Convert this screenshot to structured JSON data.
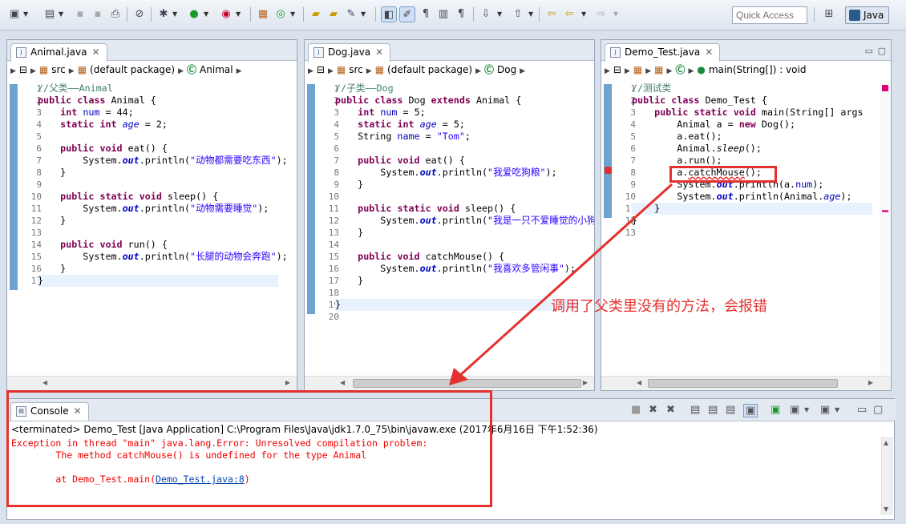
{
  "toolbar": {
    "quick_access_placeholder": "Quick Access",
    "perspective_label": "Java",
    "icons": [
      "new-icon",
      "save-icon",
      "save-all-icon",
      "print-icon",
      "debug-icon",
      "run-icon",
      "external-tools-icon",
      "new-java-project-icon",
      "new-package-icon",
      "new-class-icon",
      "open-type-icon",
      "search-icon",
      "toggle-mark-icon",
      "toggle-block-icon",
      "word-wrap-icon",
      "next-annotation-icon",
      "prev-annotation-icon",
      "back-icon",
      "forward-icon"
    ]
  },
  "editors": [
    {
      "tab": "Animal.java",
      "crumb": {
        "folder": "src",
        "package": "(default package)",
        "member": "Animal"
      },
      "lines": [
        "1",
        "2",
        "3",
        "4",
        "5",
        "6",
        "7",
        "8",
        "9",
        "10",
        "11",
        "12",
        "13",
        "14",
        "15",
        "16",
        "17"
      ],
      "code": [
        [
          {
            "c": "cm",
            "t": "//父类——Animal"
          }
        ],
        [
          {
            "c": "kw",
            "t": "public"
          },
          {
            "t": " "
          },
          {
            "c": "kw",
            "t": "class"
          },
          {
            "t": " Animal {"
          }
        ],
        [
          {
            "t": "    "
          },
          {
            "c": "kw",
            "t": "int"
          },
          {
            "t": " "
          },
          {
            "c": "fld",
            "t": "num"
          },
          {
            "t": " = 44;"
          }
        ],
        [
          {
            "t": "    "
          },
          {
            "c": "kw",
            "t": "static"
          },
          {
            "t": " "
          },
          {
            "c": "kw",
            "t": "int"
          },
          {
            "t": " "
          },
          {
            "c": "fld it",
            "t": "age"
          },
          {
            "t": " = 2;"
          }
        ],
        [
          {
            "t": ""
          }
        ],
        [
          {
            "t": "    "
          },
          {
            "c": "kw",
            "t": "public"
          },
          {
            "t": " "
          },
          {
            "c": "kw",
            "t": "void"
          },
          {
            "t": " eat() {"
          }
        ],
        [
          {
            "t": "        System."
          },
          {
            "c": "sfi",
            "t": "out"
          },
          {
            "t": ".println("
          },
          {
            "c": "st",
            "t": "\"动物都需要吃东西\""
          },
          {
            "t": ");"
          }
        ],
        [
          {
            "t": "    }"
          }
        ],
        [
          {
            "t": ""
          }
        ],
        [
          {
            "t": "    "
          },
          {
            "c": "kw",
            "t": "public"
          },
          {
            "t": " "
          },
          {
            "c": "kw",
            "t": "static"
          },
          {
            "t": " "
          },
          {
            "c": "kw",
            "t": "void"
          },
          {
            "t": " sleep() {"
          }
        ],
        [
          {
            "t": "        System."
          },
          {
            "c": "sfi",
            "t": "out"
          },
          {
            "t": ".println("
          },
          {
            "c": "st",
            "t": "\"动物需要睡觉\""
          },
          {
            "t": ");"
          }
        ],
        [
          {
            "t": "    }"
          }
        ],
        [
          {
            "t": ""
          }
        ],
        [
          {
            "t": "    "
          },
          {
            "c": "kw",
            "t": "public"
          },
          {
            "t": " "
          },
          {
            "c": "kw",
            "t": "void"
          },
          {
            "t": " run() {"
          }
        ],
        [
          {
            "t": "        System."
          },
          {
            "c": "sfi",
            "t": "out"
          },
          {
            "t": ".println("
          },
          {
            "c": "st",
            "t": "\"长腿的动物会奔跑\""
          },
          {
            "t": ");"
          }
        ],
        [
          {
            "t": "    }"
          }
        ],
        [
          {
            "t": "}"
          }
        ]
      ]
    },
    {
      "tab": "Dog.java",
      "crumb": {
        "folder": "src",
        "package": "(default package)",
        "member": "Dog"
      },
      "lines": [
        "1",
        "2",
        "3",
        "4",
        "5",
        "6",
        "7",
        "8",
        "9",
        "10",
        "11",
        "12",
        "13",
        "14",
        "15",
        "16",
        "17",
        "18",
        "19",
        "20"
      ],
      "code": [
        [
          {
            "c": "cm",
            "t": "//子类——Dog"
          }
        ],
        [
          {
            "c": "kw",
            "t": "public"
          },
          {
            "t": " "
          },
          {
            "c": "kw",
            "t": "class"
          },
          {
            "t": " Dog "
          },
          {
            "c": "kw",
            "t": "extends"
          },
          {
            "t": " Animal {"
          }
        ],
        [
          {
            "t": "    "
          },
          {
            "c": "kw",
            "t": "int"
          },
          {
            "t": " "
          },
          {
            "c": "fld",
            "t": "num"
          },
          {
            "t": " = 5;"
          }
        ],
        [
          {
            "t": "    "
          },
          {
            "c": "kw",
            "t": "static"
          },
          {
            "t": " "
          },
          {
            "c": "kw",
            "t": "int"
          },
          {
            "t": " "
          },
          {
            "c": "fld it",
            "t": "age"
          },
          {
            "t": " = 5;"
          }
        ],
        [
          {
            "t": "    String "
          },
          {
            "c": "fld",
            "t": "name"
          },
          {
            "t": " = "
          },
          {
            "c": "st",
            "t": "\"Tom\""
          },
          {
            "t": ";"
          }
        ],
        [
          {
            "t": ""
          }
        ],
        [
          {
            "t": "    "
          },
          {
            "c": "kw",
            "t": "public"
          },
          {
            "t": " "
          },
          {
            "c": "kw",
            "t": "void"
          },
          {
            "t": " eat() {"
          }
        ],
        [
          {
            "t": "        System."
          },
          {
            "c": "sfi",
            "t": "out"
          },
          {
            "t": ".println("
          },
          {
            "c": "st",
            "t": "\"我爱吃狗粮\""
          },
          {
            "t": ");"
          }
        ],
        [
          {
            "t": "    }"
          }
        ],
        [
          {
            "t": ""
          }
        ],
        [
          {
            "t": "    "
          },
          {
            "c": "kw",
            "t": "public"
          },
          {
            "t": " "
          },
          {
            "c": "kw",
            "t": "static"
          },
          {
            "t": " "
          },
          {
            "c": "kw",
            "t": "void"
          },
          {
            "t": " sleep() {"
          }
        ],
        [
          {
            "t": "        System."
          },
          {
            "c": "sfi",
            "t": "out"
          },
          {
            "t": ".println("
          },
          {
            "c": "st",
            "t": "\"我是一只不爱睡觉的小狗\""
          },
          {
            "t": ");"
          }
        ],
        [
          {
            "t": "    }"
          }
        ],
        [
          {
            "t": ""
          }
        ],
        [
          {
            "t": "    "
          },
          {
            "c": "kw",
            "t": "public"
          },
          {
            "t": " "
          },
          {
            "c": "kw",
            "t": "void"
          },
          {
            "t": " catchMouse() {"
          }
        ],
        [
          {
            "t": "        System."
          },
          {
            "c": "sfi",
            "t": "out"
          },
          {
            "t": ".println("
          },
          {
            "c": "st",
            "t": "\"我喜欢多管闲事\""
          },
          {
            "t": ");"
          }
        ],
        [
          {
            "t": "    }"
          }
        ],
        [
          {
            "t": ""
          }
        ],
        [
          {
            "t": "}"
          }
        ],
        [
          {
            "t": ""
          }
        ]
      ]
    },
    {
      "tab": "Demo_Test.java",
      "crumb": {
        "member": "main(String[]) : void"
      },
      "lines": [
        "1",
        "2",
        "3",
        "4",
        "5",
        "6",
        "7",
        "8",
        "9",
        "10",
        "11",
        "12",
        "13"
      ],
      "code": [
        [
          {
            "c": "cm",
            "t": "//测试类"
          }
        ],
        [
          {
            "c": "kw",
            "t": "public"
          },
          {
            "t": " "
          },
          {
            "c": "kw",
            "t": "class"
          },
          {
            "t": " Demo_Test {"
          }
        ],
        [
          {
            "t": "    "
          },
          {
            "c": "kw",
            "t": "public"
          },
          {
            "t": " "
          },
          {
            "c": "kw",
            "t": "static"
          },
          {
            "t": " "
          },
          {
            "c": "kw",
            "t": "void"
          },
          {
            "t": " main(String[] args"
          }
        ],
        [
          {
            "t": "        Animal a = "
          },
          {
            "c": "kw",
            "t": "new"
          },
          {
            "t": " Dog();"
          }
        ],
        [
          {
            "t": "        a.eat();"
          }
        ],
        [
          {
            "t": "        Animal."
          },
          {
            "c": "it",
            "t": "sleep"
          },
          {
            "t": "();"
          }
        ],
        [
          {
            "t": "        a.run();"
          }
        ],
        [
          {
            "t": "        a."
          },
          {
            "c": "err",
            "t": "catchMouse"
          },
          {
            "t": "();"
          }
        ],
        [
          {
            "t": "        System."
          },
          {
            "c": "sfi",
            "t": "out"
          },
          {
            "t": ".println(a."
          },
          {
            "c": "fld",
            "t": "num"
          },
          {
            "t": ");"
          }
        ],
        [
          {
            "t": "        System."
          },
          {
            "c": "sfi",
            "t": "out"
          },
          {
            "t": ".println(Animal."
          },
          {
            "c": "fld it",
            "t": "age"
          },
          {
            "t": ");"
          }
        ],
        [
          {
            "t": "    }"
          }
        ],
        [
          {
            "t": "}"
          }
        ],
        [
          {
            "t": ""
          }
        ]
      ]
    }
  ],
  "annotation": "调用了父类里没有的方法，会报错",
  "console": {
    "tab": "Console",
    "title": "<terminated> Demo_Test [Java Application] C:\\Program Files\\Java\\jdk1.7.0_75\\bin\\javaw.exe (2017年6月16日 下午1:52:36)",
    "line1": "Exception in thread \"main\" java.lang.Error: Unresolved compilation problem: ",
    "line2": "\tThe method catchMouse() is undefined for the type Animal",
    "line3": "",
    "line4_prefix": "\tat Demo_Test.main(",
    "line4_link": "Demo_Test.java:8",
    "line4_suffix": ")"
  },
  "colors": {
    "annotation_red": "#e5312e",
    "keyword": "#7f0055",
    "comment": "#3f7f5f",
    "string": "#2a00ff",
    "error": "#e00000"
  }
}
